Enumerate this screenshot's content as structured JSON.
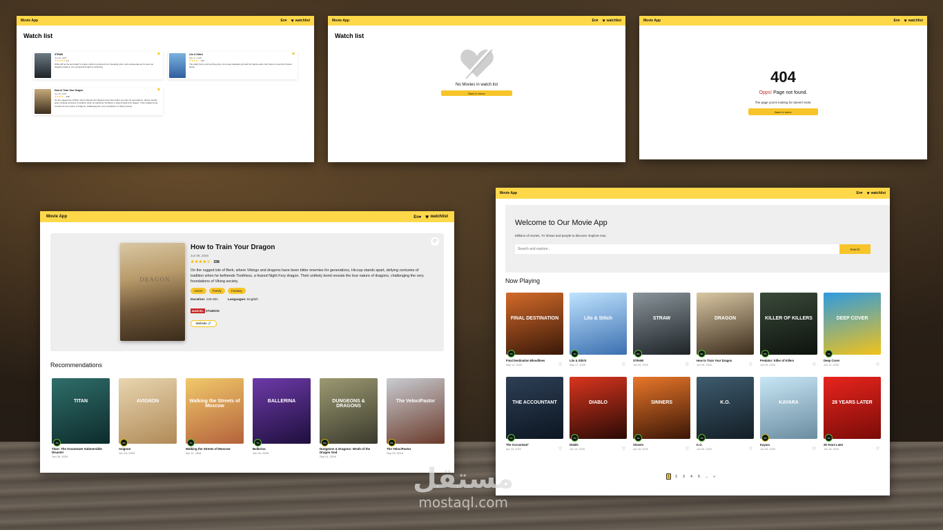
{
  "app_name": "Movie App",
  "nav": {
    "lang": "En",
    "lang_caret": "▾",
    "watchlist_label": "watchlist",
    "heart": "♥"
  },
  "watchlist_page": {
    "title": "Watch list",
    "items": [
      {
        "title": "STRAW",
        "date": "Jun 06, 2025",
        "stars": "★★★★★",
        "votes": "4.6",
        "overview": "What will be the last straw? A single mother is pushed to her breaking point, and a desperate act to save her daughter leads to one unexpected night of reckoning.",
        "colors": [
          "#6e7a82",
          "#1d2327"
        ]
      },
      {
        "title": "Lilo & Stitch",
        "date": "May 17, 2025",
        "stars": "★★★★☆",
        "votes": "726",
        "overview": "The wildly funny and touching story of a lonely Hawaiian girl and the fugitive alien who helps to mend her broken family.",
        "colors": [
          "#7ab3e0",
          "#2f5f9e"
        ]
      },
      {
        "title": "How to Train Your Dragon",
        "date": "Jun 06, 2025",
        "stars": "★★★★☆",
        "votes": "338",
        "overview": "On the rugged isle of Berk, where Vikings and dragons have been bitter enemies for generations, Hiccup stands apart, defying centuries of tradition when he befriends Toothless, a feared Night Fury dragon. Their unlikely bond reveals the true nature of dragons, challenging the very foundations of Viking society.",
        "colors": [
          "#c6aa7a",
          "#3b2c1c"
        ]
      }
    ]
  },
  "empty_page": {
    "title": "Watch list",
    "message": "No Movies in watch list",
    "button": "Back to home"
  },
  "not_found_page": {
    "code": "404",
    "opps": "Opps!",
    "message": "Page not found.",
    "sub": "The page you're looking for doesn't exist.",
    "button": "Back to home"
  },
  "detail_page": {
    "title": "How to Train Your Dragon",
    "date": "Jun 06, 2025",
    "stars": "★★★★☆",
    "votes": "338",
    "overview": "On the rugged isle of Berk, where Vikings and dragons have been bitter enemies for generations, Hiccup stands apart, defying centuries of tradition when he befriends Toothless, a feared Night Fury dragon. Their unlikely bond reveals the true nature of dragons, challenging the very foundations of Viking society.",
    "genres": [
      "Action",
      "Family",
      "Fantasy"
    ],
    "duration_label": "Duration:",
    "duration": "125 Min",
    "languages_label": "Languages:",
    "languages": "English",
    "studio_m": "MARVEL",
    "studio_s": "STUDIOS",
    "website": "Website 🔗",
    "poster_text": "DRAGON",
    "recommendations_title": "Recommendations",
    "recommendations": [
      {
        "name": "Titan: The OceanGate Submersible Disaster",
        "date": "Jun 06, 2025",
        "score": "7%",
        "colors": [
          "#2f6e6a",
          "#0d2b2b"
        ],
        "poster_text": "TITAN"
      },
      {
        "name": "Avignon",
        "date": "Jun 18, 2025",
        "score": "6%",
        "colors": [
          "#e8d5b0",
          "#b08a57"
        ],
        "poster_text": "AVIGNON"
      },
      {
        "name": "Walking the Streets of Moscow",
        "date": "Apr 11, 1964",
        "score": "7%",
        "colors": [
          "#f1c96a",
          "#b4623c"
        ],
        "poster_text": "Walking the Streets of Moscow"
      },
      {
        "name": "Ballerina",
        "date": "Jun 04, 2025",
        "score": "7%",
        "colors": [
          "#6d3aa8",
          "#1e0f3d"
        ],
        "poster_text": "BALLERINA"
      },
      {
        "name": "Dungeons & Dragons: Wrath of the Dragon God",
        "date": "Sep 01, 2005",
        "score": "6%",
        "colors": [
          "#9c9a72",
          "#3b3a2c"
        ],
        "poster_text": "DUNGEONS & DRAGONS"
      },
      {
        "name": "The VelociPastor",
        "date": "Sep 20, 2018",
        "score": "5%",
        "colors": [
          "#c9ccd2",
          "#6a3a2a"
        ],
        "poster_text": "The VelociPastor"
      }
    ]
  },
  "home_page": {
    "welcome": "Welcome to Our Movie App",
    "tagline": "Millions of movies, TV shows and people to discover. Explore now.",
    "search_placeholder": "Search and explore...",
    "search_button": "Search",
    "now_playing_title": "Now Playing",
    "movies": [
      {
        "name": "Final Destination Bloodlines",
        "date": "May 14, 2025",
        "score": "7%",
        "colors": [
          "#d26a2a",
          "#3a1808"
        ],
        "poster_text": "FINAL DESTINATION"
      },
      {
        "name": "Lilo & Stitch",
        "date": "May 17, 2025",
        "score": "7%",
        "colors": [
          "#bfe3ff",
          "#3b6fb0"
        ],
        "poster_text": "Lilo & Stitch"
      },
      {
        "name": "STRAW",
        "date": "Jun 05, 2025",
        "score": "8%",
        "colors": [
          "#8a949a",
          "#1d2327"
        ],
        "poster_text": "STRAW"
      },
      {
        "name": "How to Train Your Dragon",
        "date": "Jun 06, 2025",
        "score": "8%",
        "colors": [
          "#d9c7a3",
          "#3b2c1c"
        ],
        "poster_text": "DRAGON"
      },
      {
        "name": "Predator: Killer of Killers",
        "date": "Jun 05, 2025",
        "score": "8%",
        "colors": [
          "#3a4a3a",
          "#0d120d"
        ],
        "poster_text": "KILLER OF KILLERS"
      },
      {
        "name": "Deep Cover",
        "date": "Jun 12, 2025",
        "score": "7%",
        "colors": [
          "#2e9be0",
          "#f2c21a"
        ],
        "poster_text": "DEEP COVER"
      },
      {
        "name": "The Accountant²",
        "date": "Apr 23, 2025",
        "score": "7%",
        "colors": [
          "#2d3f55",
          "#0d1622"
        ],
        "poster_text": "THE ACCOUNTANT"
      },
      {
        "name": "Diablo",
        "date": "Jun 13, 2025",
        "score": "7%",
        "colors": [
          "#d8351e",
          "#2a0a05"
        ],
        "poster_text": "DIABLO"
      },
      {
        "name": "Sinners",
        "date": "Apr 16, 2025",
        "score": "7%",
        "colors": [
          "#e9772a",
          "#3a1606"
        ],
        "poster_text": "SINNERS"
      },
      {
        "name": "K.O.",
        "date": "Jun 06, 2025",
        "score": "7%",
        "colors": [
          "#3e5b6e",
          "#131e26"
        ],
        "poster_text": "K.O."
      },
      {
        "name": "Kayara",
        "date": "Jun 05, 2025",
        "score": "6%",
        "colors": [
          "#c8e6f5",
          "#6a8ca0"
        ],
        "poster_text": "KAYARA"
      },
      {
        "name": "28 Years Later",
        "date": "Jun 18, 2025",
        "score": "7%",
        "colors": [
          "#e8241d",
          "#7a0c08"
        ],
        "poster_text": "28 YEARS LATER"
      }
    ],
    "pages": [
      "1",
      "2",
      "3",
      "4",
      "5",
      "...",
      "»"
    ]
  },
  "watermark": {
    "arabic": "مستقل",
    "latin": "mostaql.com"
  }
}
